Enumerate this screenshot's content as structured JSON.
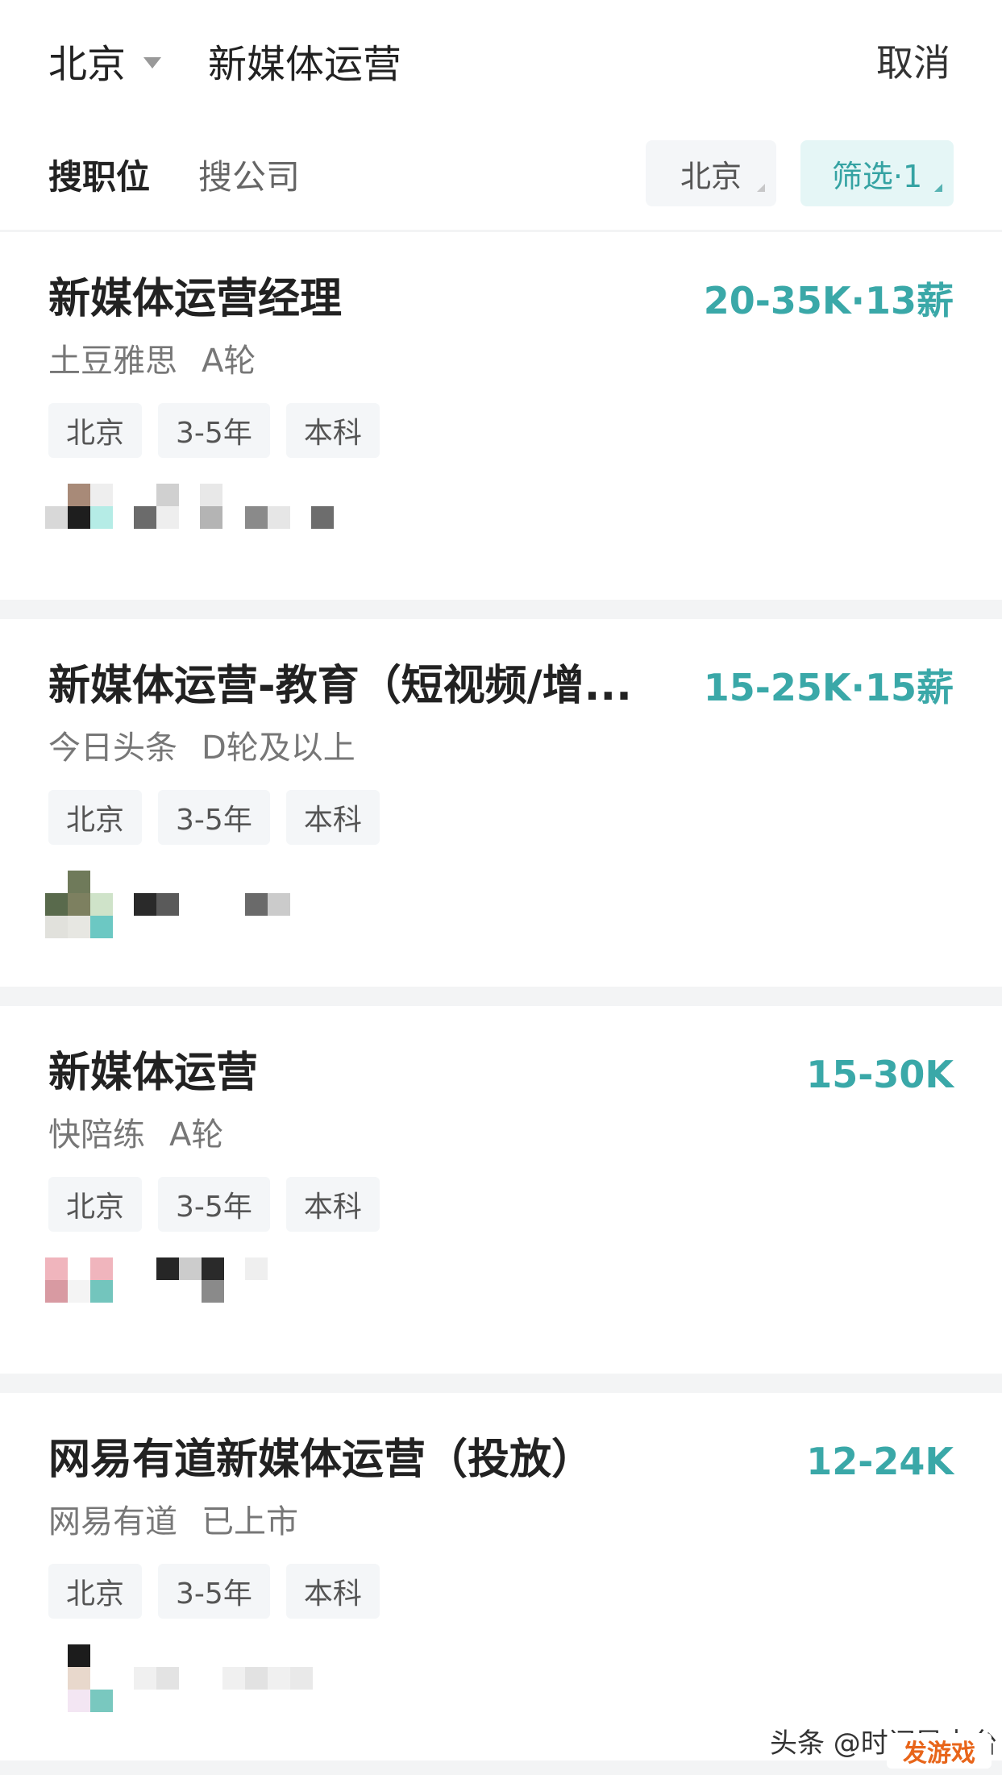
{
  "header": {
    "city": "北京",
    "search_value": "新媒体运营",
    "cancel_label": "取消"
  },
  "tabs": [
    {
      "label": "搜职位",
      "active": true
    },
    {
      "label": "搜公司",
      "active": false
    }
  ],
  "filters": {
    "city_chip": "北京",
    "filter_chip": "筛选·1"
  },
  "colors": {
    "accent": "#3aa8a8",
    "chip_bg": "#f4f6f8",
    "filter_bg": "#e5f6f6"
  },
  "jobs": [
    {
      "title": "新媒体运营经理",
      "salary": "20-35K·13薪",
      "company": "土豆雅思",
      "stage": "A轮",
      "tags": [
        "北京",
        "3-5年",
        "本科"
      ]
    },
    {
      "title": "新媒体运营-教育（短视频/增...",
      "salary": "15-25K·15薪",
      "company": "今日头条",
      "stage": "D轮及以上",
      "tags": [
        "北京",
        "3-5年",
        "本科"
      ]
    },
    {
      "title": "新媒体运营",
      "salary": "15-30K",
      "company": "快陪练",
      "stage": "A轮",
      "tags": [
        "北京",
        "3-5年",
        "本科"
      ]
    },
    {
      "title": "网易有道新媒体运营（投放）",
      "salary": "12-24K",
      "company": "网易有道",
      "stage": "已上市",
      "tags": [
        "北京",
        "3-5年",
        "本科"
      ]
    }
  ],
  "watermark": "头条 @时间导电台",
  "logo_text": "发游戏"
}
